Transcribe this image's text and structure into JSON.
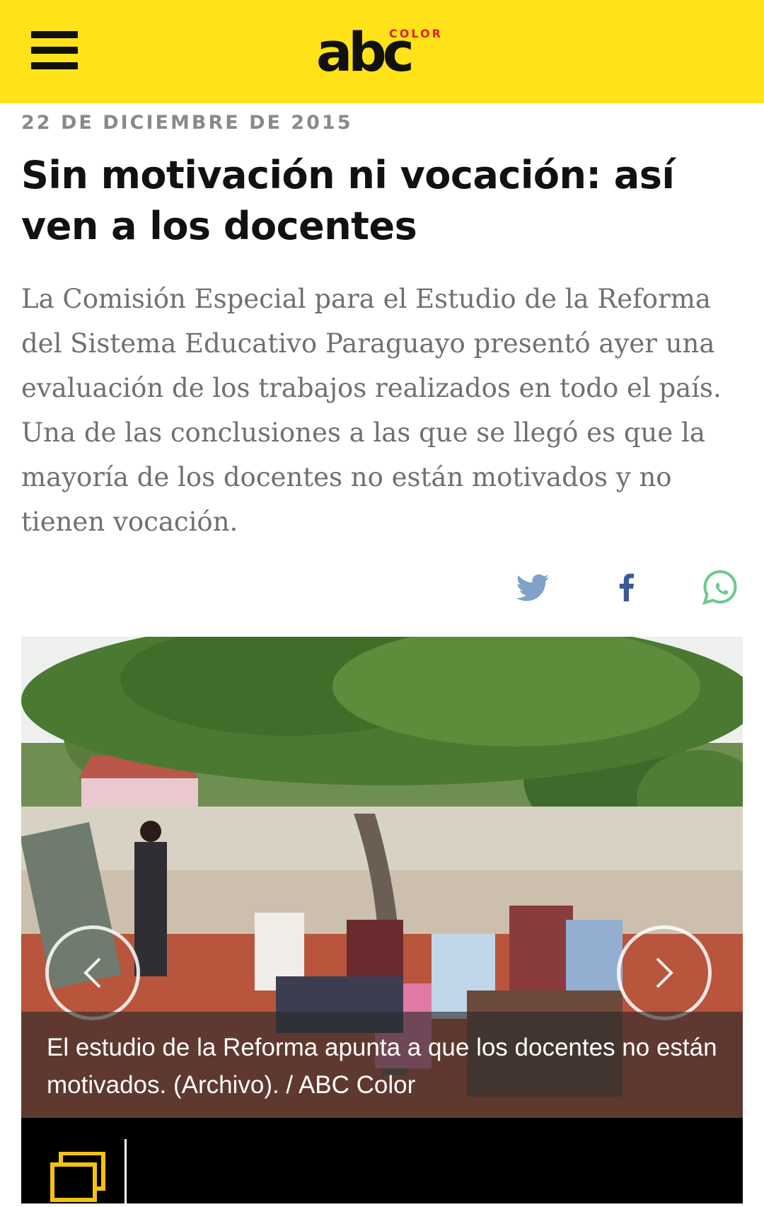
{
  "header": {
    "logo": {
      "main": "abc",
      "sub": "COLOR"
    },
    "colors": {
      "background": "#ffe318",
      "logo": "#111111",
      "logo_accent": "#e0201b"
    }
  },
  "article": {
    "date": "22 DE DICIEMBRE DE 2015",
    "headline": "Sin motivación ni vocación: así ven a los docentes",
    "lead": "La Comisión Especial para el Estudio de la Reforma del Sistema Educativo Paraguayo presentó ayer una evaluación de los trabajos realizados en todo el país. Una de las conclusiones a las que se llegó es que la mayoría de los docentes no están motivados y no tienen vocación."
  },
  "share": {
    "icons": [
      "twitter-icon",
      "facebook-icon",
      "whatsapp-icon"
    ],
    "colors": {
      "twitter": "#7fa2c6",
      "facebook": "#3b5998",
      "whatsapp": "#6cc98d"
    }
  },
  "photo": {
    "caption": "El estudio de la Reforma apunta a que los docentes no están motivados. (Archivo). / ABC Color",
    "icons": {
      "prev": "chevron-left-icon",
      "next": "chevron-right-icon"
    }
  },
  "gallery": {
    "icon": "gallery-icon",
    "colors": {
      "icon": "#f5c20d",
      "bar": "#000000"
    }
  }
}
